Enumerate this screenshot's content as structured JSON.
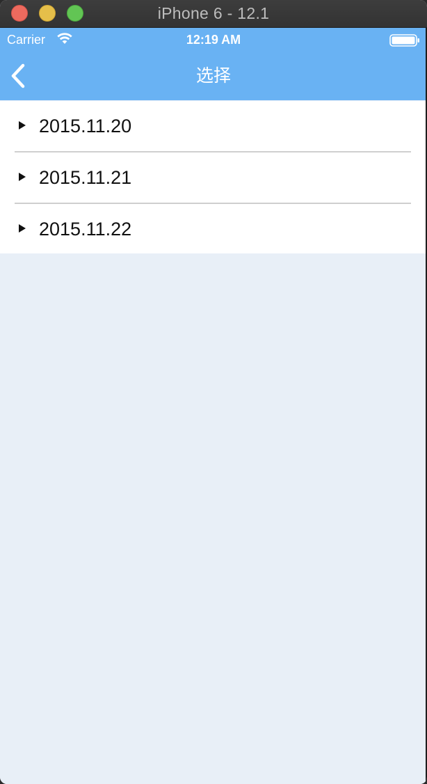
{
  "window": {
    "title": "iPhone 6 - 12.1"
  },
  "status_bar": {
    "carrier": "Carrier",
    "time": "12:19 AM",
    "wifi_icon": "wifi-icon",
    "battery_icon": "battery-icon"
  },
  "nav": {
    "title": "选择",
    "back_icon": "chevron-left-icon"
  },
  "list": {
    "items": [
      {
        "label": "2015.11.20",
        "icon": "triangle-right-icon"
      },
      {
        "label": "2015.11.21",
        "icon": "triangle-right-icon"
      },
      {
        "label": "2015.11.22",
        "icon": "triangle-right-icon"
      }
    ]
  },
  "colors": {
    "nav_bar": "#69b2f3",
    "background": "#e8eff7",
    "divider": "#cfcfcf"
  }
}
